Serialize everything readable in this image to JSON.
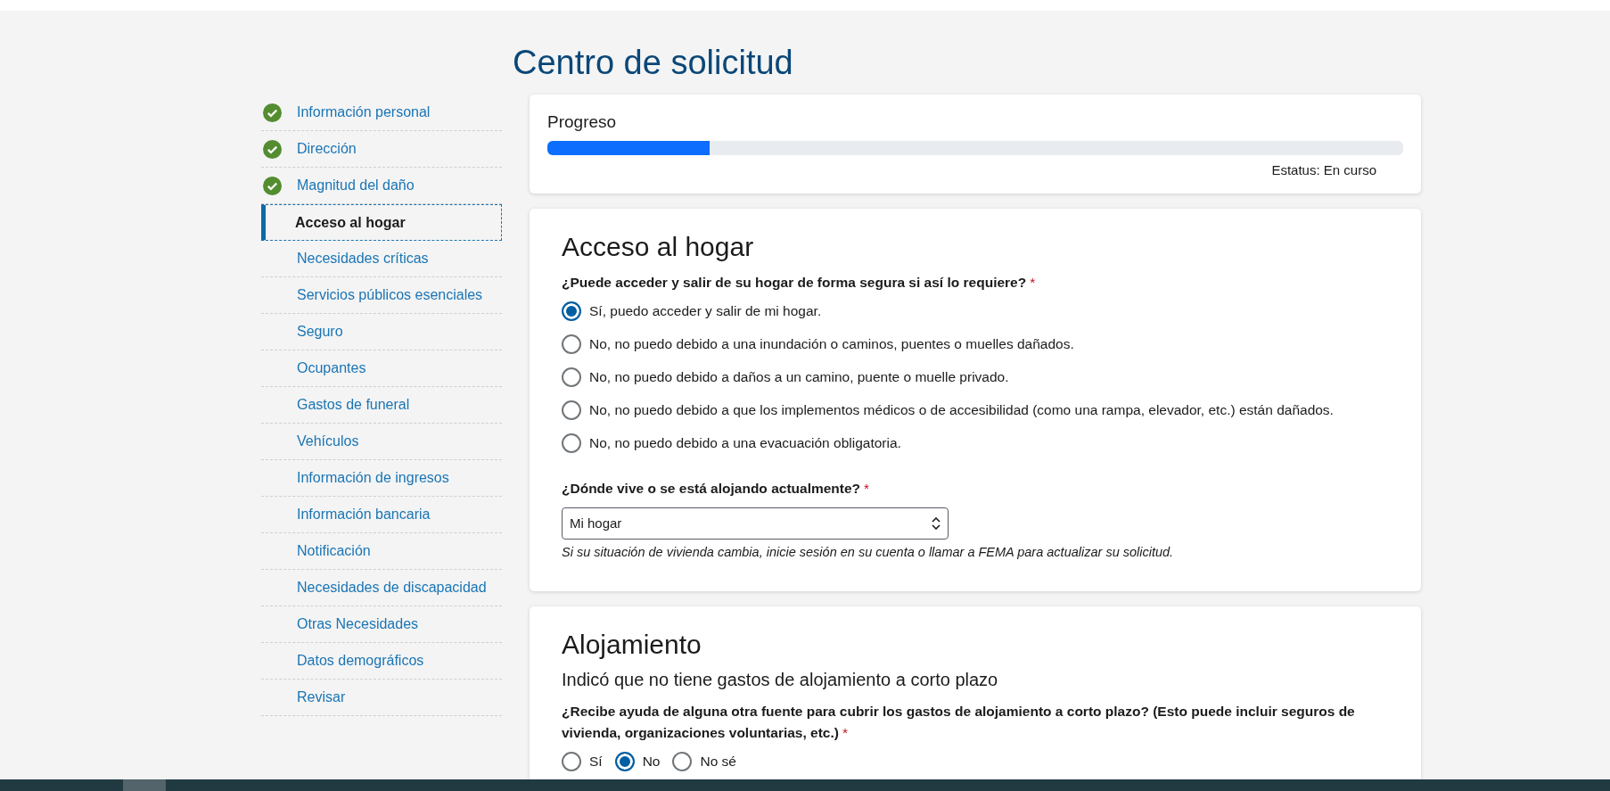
{
  "page": {
    "title": "Centro de solicitud"
  },
  "sidebar": {
    "items": [
      {
        "label": "Información personal",
        "completed": true,
        "selected": false
      },
      {
        "label": "Dirección",
        "completed": true,
        "selected": false
      },
      {
        "label": "Magnitud del daño",
        "completed": true,
        "selected": false
      },
      {
        "label": "Acceso al hogar",
        "completed": false,
        "selected": true
      },
      {
        "label": "Necesidades críticas",
        "completed": false,
        "selected": false
      },
      {
        "label": "Servicios públicos esenciales",
        "completed": false,
        "selected": false
      },
      {
        "label": "Seguro",
        "completed": false,
        "selected": false
      },
      {
        "label": "Ocupantes",
        "completed": false,
        "selected": false
      },
      {
        "label": "Gastos de funeral",
        "completed": false,
        "selected": false
      },
      {
        "label": "Vehículos",
        "completed": false,
        "selected": false
      },
      {
        "label": "Información de ingresos",
        "completed": false,
        "selected": false
      },
      {
        "label": "Información bancaria",
        "completed": false,
        "selected": false
      },
      {
        "label": "Notificación",
        "completed": false,
        "selected": false
      },
      {
        "label": "Necesidades de discapacidad",
        "completed": false,
        "selected": false
      },
      {
        "label": "Otras Necesidades",
        "completed": false,
        "selected": false
      },
      {
        "label": "Datos demográficos",
        "completed": false,
        "selected": false
      },
      {
        "label": "Revisar",
        "completed": false,
        "selected": false
      }
    ]
  },
  "progress": {
    "title": "Progreso",
    "level": 0.19,
    "status": "Estatus: En curso"
  },
  "sections": [
    {
      "title": "Acceso al hogar",
      "fields": [
        {
          "kind": "radio-list",
          "label": "¿Puede acceder y salir de su hogar de forma segura si así lo requiere?",
          "required_mark": "*",
          "options": [
            {
              "label": "Sí, puedo acceder y salir de mi hogar.",
              "selected": true
            },
            {
              "label": "No, no puedo debido a una inundación o caminos, puentes o muelles dañados.",
              "selected": false
            },
            {
              "label": "No, no puedo debido a daños a un camino, puente o muelle privado.",
              "selected": false
            },
            {
              "label": "No, no puedo debido a que los implementos médicos o de accesibilidad (como una rampa, elevador, etc.) están dañados.",
              "selected": false
            },
            {
              "label": "No, no puedo debido a una evacuación obligatoria.",
              "selected": false
            }
          ]
        },
        {
          "kind": "select",
          "label": "¿Dónde vive o se está alojando actualmente?",
          "required_mark": "*",
          "value": "Mi hogar",
          "help": "Si su situación de vivienda cambia, inicie sesión en su cuenta o llamar a FEMA para actualizar su solicitud."
        }
      ]
    },
    {
      "title": "Alojamiento",
      "subtitle": "Indicó que no tiene gastos de alojamiento a corto plazo",
      "fields": [
        {
          "kind": "radio-inline",
          "label": "¿Recibe ayuda de alguna otra fuente para cubrir los gastos de alojamiento a corto plazo? (Esto puede incluir seguros de vivienda, organizaciones voluntarias, etc.)",
          "required_mark": "*",
          "options": [
            {
              "label": "Sí",
              "selected": false
            },
            {
              "label": "No",
              "selected": true
            },
            {
              "label": "No sé",
              "selected": false
            }
          ]
        }
      ]
    }
  ]
}
